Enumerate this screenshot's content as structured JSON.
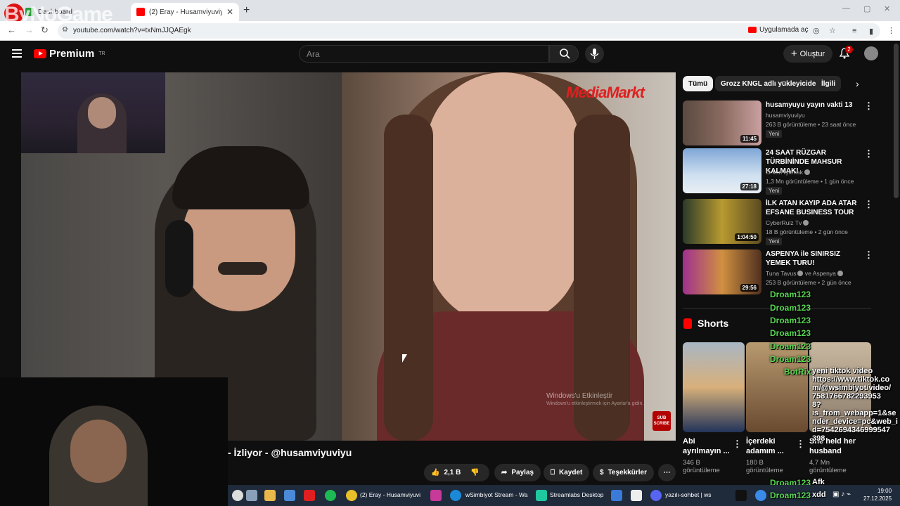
{
  "browser": {
    "tabs": [
      {
        "title": "Dashboard"
      },
      {
        "title": "(2) Eray - Husamviyuviyu, h"
      }
    ],
    "url": "youtube.com/watch?v=txNmJJQAEgk",
    "open_in_app": "Uygulamada aç"
  },
  "watermark": "ByNoGame",
  "youtube": {
    "logo": "Premium",
    "logo_region": "TR",
    "search_placeholder": "Ara",
    "create_label": "Oluştur",
    "notification_count": "2"
  },
  "video": {
    "title": "- İzliyor - @husamviyuviyu",
    "overlay_brand": "MediaMarkt",
    "activate_title": "Windows'u Etkinleştir",
    "activate_sub": "Windows'u etkinleştirmek için Ayarlar'a gidin.",
    "subscribe_badge": "SUB SCRIBE",
    "likes": "2,1 B",
    "share": "Paylaş",
    "save": "Kaydet",
    "thanks": "Teşekkürler"
  },
  "chips": [
    "Tümü",
    "Grozz KNGL adlı yükleyiciden",
    "İlgili"
  ],
  "recommended": [
    {
      "title": "husamyuyu yayın vakti 13",
      "channel": "husamviyuviyu",
      "meta": "263 B görüntüleme • 23 saat önce",
      "badge": "Yeni",
      "duration": "11:45",
      "verified": false
    },
    {
      "title": "24 SAAT RÜZGAR TÜRBİNİNDE MAHSUR KALMAK!",
      "channel": "Orkun Işıtmak",
      "meta": "1,3 Mn görüntüleme • 1 gün önce",
      "badge": "Yeni",
      "duration": "27:18",
      "verified": true
    },
    {
      "title": "İLK ATAN KAYIP ADA ATAR EFSANE BUSINESS TOUR",
      "channel": "CyberRulz Tv",
      "meta": "18 B görüntüleme • 2 gün önce",
      "badge": "Yeni",
      "duration": "1:04:50",
      "verified": true
    },
    {
      "title": "ASPENYA ile SINIRSIZ YEMEK TURU!",
      "channel": "Tuna Tavus",
      "channel2": "ve Aspenya",
      "meta": "253 B görüntüleme • 2 gün önce",
      "badge": "Yeni",
      "duration": "29:56",
      "verified": true
    }
  ],
  "shorts": {
    "heading": "Shorts",
    "items": [
      {
        "title1": "Abi",
        "title2": "ayrılmayın ...",
        "views": "346 B",
        "views2": "görüntüleme"
      },
      {
        "title1": "İçerdeki",
        "title2": "adamım ...",
        "views": "180 B",
        "views2": "görüntüleme"
      },
      {
        "title1": "She held her",
        "title2": "husband",
        "views": "4,7 Mn",
        "views2": "görüntüleme"
      }
    ]
  },
  "chat": {
    "user": "Droam123",
    "bot": "BotRix",
    "lines": [
      "yeni tiktok video",
      "https://www.tiktok.co",
      "m/@wsimbiyot/video/",
      "7581766782293953",
      "8?",
      "is_from_webapp=1&se",
      "nder_device=pc&web_i",
      "d=7542694346999547",
      "398"
    ],
    "afk": "Afk",
    "xdd": "xdd"
  },
  "taskbar": {
    "items": [
      "(2) Eray - Husamviyuvi",
      "wSimbiyot Stream - Wa",
      "Streamlabs Desktop",
      "yazılı-sohbet | ws"
    ],
    "time": "19:00",
    "date": "27.12.2025"
  }
}
